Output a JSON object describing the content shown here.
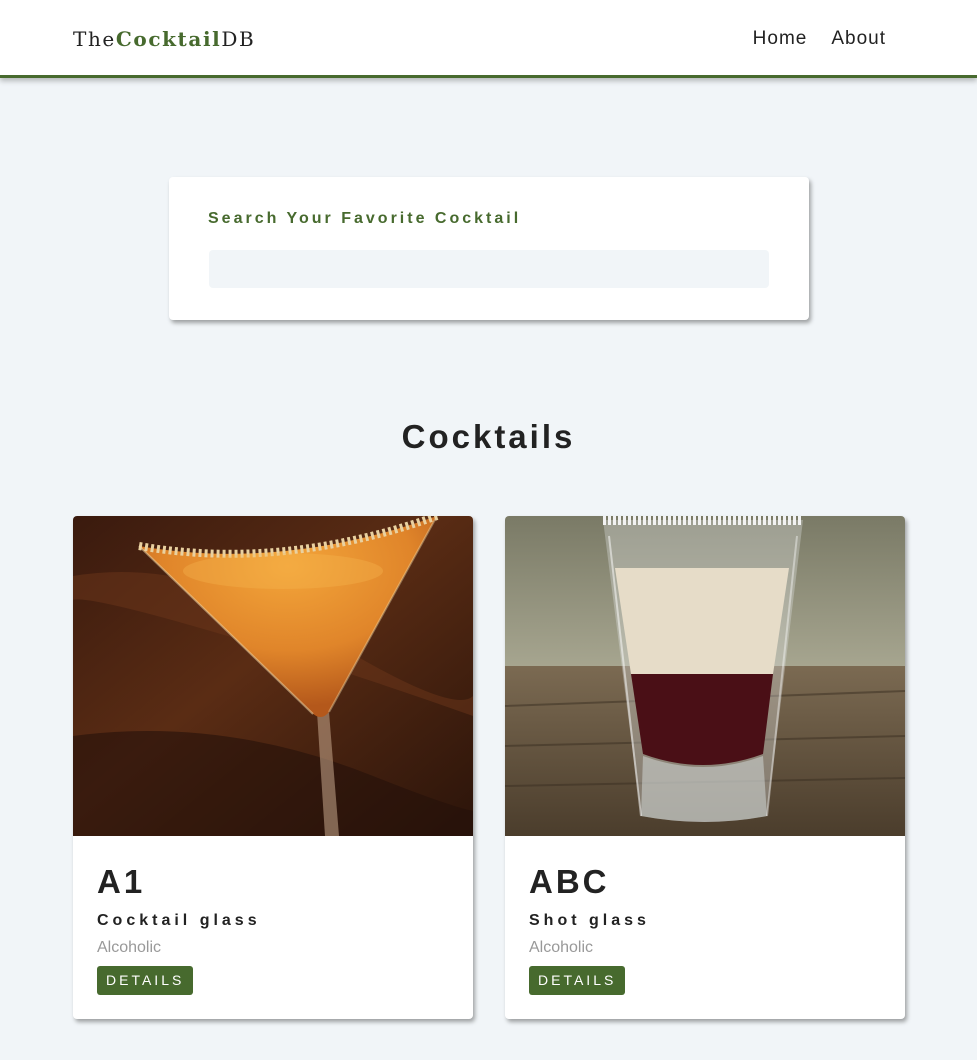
{
  "navbar": {
    "logo_prefix": "The",
    "logo_mid": "Cocktail",
    "logo_suffix": "DB",
    "links": [
      {
        "label": "Home"
      },
      {
        "label": "About"
      }
    ]
  },
  "search": {
    "label": "Search Your Favorite Cocktail",
    "value": "",
    "placeholder": ""
  },
  "section": {
    "title": "Cocktails"
  },
  "cocktails": [
    {
      "name": "A1",
      "glass": "Cocktail glass",
      "info": "Alcoholic",
      "button_label": "DETAILS",
      "image_icon": "martini-glass-image"
    },
    {
      "name": "ABC",
      "glass": "Shot glass",
      "info": "Alcoholic",
      "button_label": "DETAILS",
      "image_icon": "shot-glass-image"
    }
  ],
  "colors": {
    "accent": "#476a2e",
    "background": "#f1f5f8",
    "card": "#ffffff",
    "text": "#222222",
    "muted": "#999999"
  }
}
